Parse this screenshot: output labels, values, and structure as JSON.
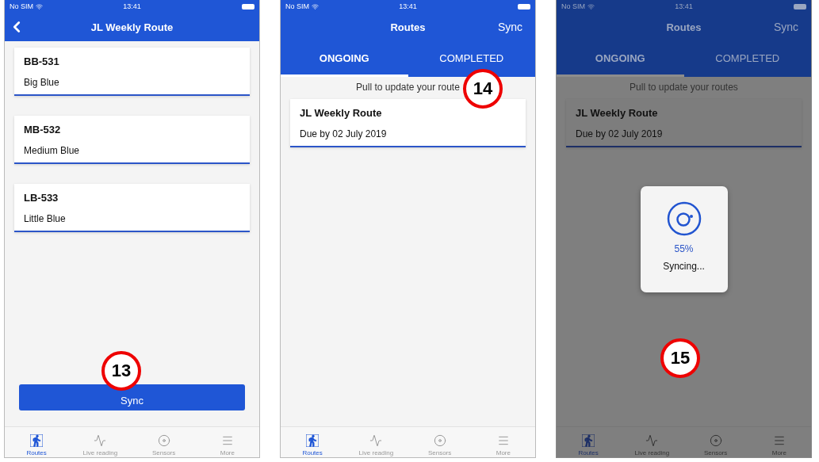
{
  "screens": [
    {
      "kind": "route_detail",
      "dimmed": false,
      "status_bar": {
        "carrier": "No SIM",
        "time": "13:41"
      },
      "nav": {
        "title": "JL Weekly Route"
      },
      "sensors": [
        {
          "code": "BB-531",
          "name": "Big Blue"
        },
        {
          "code": "MB-532",
          "name": "Medium Blue"
        },
        {
          "code": "LB-533",
          "name": "Little Blue"
        }
      ],
      "sync_button": "Sync",
      "callout": {
        "label": "13",
        "kind": "button"
      },
      "tab_bar": [
        {
          "label": "Routes",
          "selected": true
        },
        {
          "label": "Live reading",
          "selected": false
        },
        {
          "label": "Sensors",
          "selected": false
        },
        {
          "label": "More",
          "selected": false
        }
      ]
    },
    {
      "kind": "routes",
      "dimmed": false,
      "status_bar": {
        "carrier": "No SIM",
        "time": "13:41"
      },
      "nav": {
        "title": "Routes",
        "action": "Sync"
      },
      "tabs": [
        {
          "label": "ONGOING",
          "selected": true
        },
        {
          "label": "COMPLETED",
          "selected": false
        }
      ],
      "hint": "Pull to update your route",
      "routes": [
        {
          "name": "JL Weekly Route",
          "due": "Due by 02 July 2019"
        }
      ],
      "callout": {
        "label": "14",
        "kind": "hint"
      },
      "tab_bar": [
        {
          "label": "Routes",
          "selected": true
        },
        {
          "label": "Live reading",
          "selected": false
        },
        {
          "label": "Sensors",
          "selected": false
        },
        {
          "label": "More",
          "selected": false
        }
      ]
    },
    {
      "kind": "routes",
      "dimmed": true,
      "status_bar": {
        "carrier": "No SIM",
        "time": "13:41"
      },
      "nav": {
        "title": "Routes",
        "action": "Sync"
      },
      "tabs": [
        {
          "label": "ONGOING",
          "selected": true
        },
        {
          "label": "COMPLETED",
          "selected": false
        }
      ],
      "hint": "Pull to update your routes",
      "routes": [
        {
          "name": "JL Weekly Route",
          "due": "Due by 02 July 2019"
        }
      ],
      "dialog": {
        "percent": "55%",
        "message": "Syncing..."
      },
      "callout": {
        "label": "15",
        "kind": "content"
      },
      "tab_bar": [
        {
          "label": "Routes",
          "selected": true
        },
        {
          "label": "Live reading",
          "selected": false
        },
        {
          "label": "Sensors",
          "selected": false
        },
        {
          "label": "More",
          "selected": false
        }
      ]
    }
  ]
}
